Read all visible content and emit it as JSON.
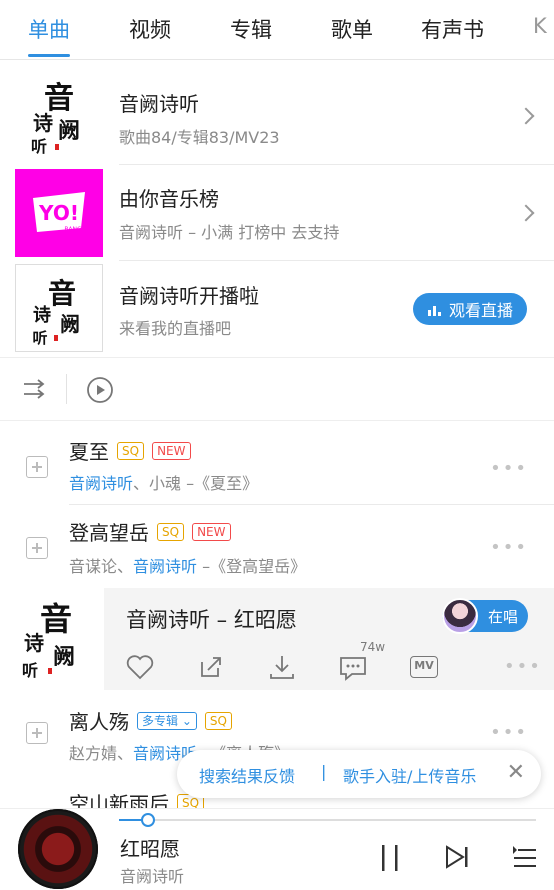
{
  "tabs": [
    {
      "label": "单曲"
    },
    {
      "label": "视频"
    },
    {
      "label": "专辑"
    },
    {
      "label": "歌单"
    },
    {
      "label": "有声书"
    },
    {
      "label": "K"
    }
  ],
  "artist": {
    "name": "音阙诗听",
    "stats": "歌曲84/专辑83/MV23"
  },
  "chart": {
    "name": "由你音乐榜",
    "desc": "音阙诗听 – 小满 打榜中 去支持"
  },
  "live": {
    "title": "音阙诗听开播啦",
    "desc": "来看我的直播吧",
    "button": "观看直播"
  },
  "songs": [
    {
      "name": "夏至",
      "badges": [
        "SQ",
        "NEW"
      ],
      "artists_hl": "音阙诗听",
      "rest": "、小魂 –《夏至》"
    },
    {
      "name": "登高望岳",
      "badges": [
        "SQ",
        "NEW"
      ],
      "artists_pre": "音谋论、",
      "artists_hl": "音阙诗听",
      "rest": " –《登高望岳》"
    }
  ],
  "now_playing_row": {
    "title": "音阙诗听 – 红昭愿",
    "singing": "在唱",
    "comment_count": "74w",
    "mv_label": "MV"
  },
  "songs2": [
    {
      "name": "离人殇",
      "badge_album": "多专辑",
      "badge_sq": "SQ",
      "artists_pre": "赵方婧、",
      "artists_hl": "音阙诗听",
      "rest": " –《离人殇》"
    },
    {
      "name": "空山新雨后",
      "badge_sq": "SQ"
    }
  ],
  "feedback": {
    "left": "搜索结果反馈",
    "sep": "|",
    "right": "歌手入驻/上传音乐",
    "close": "✕"
  },
  "player": {
    "title": "红昭愿",
    "artist": "音阙诗听",
    "progress_fraction": 0.07
  }
}
